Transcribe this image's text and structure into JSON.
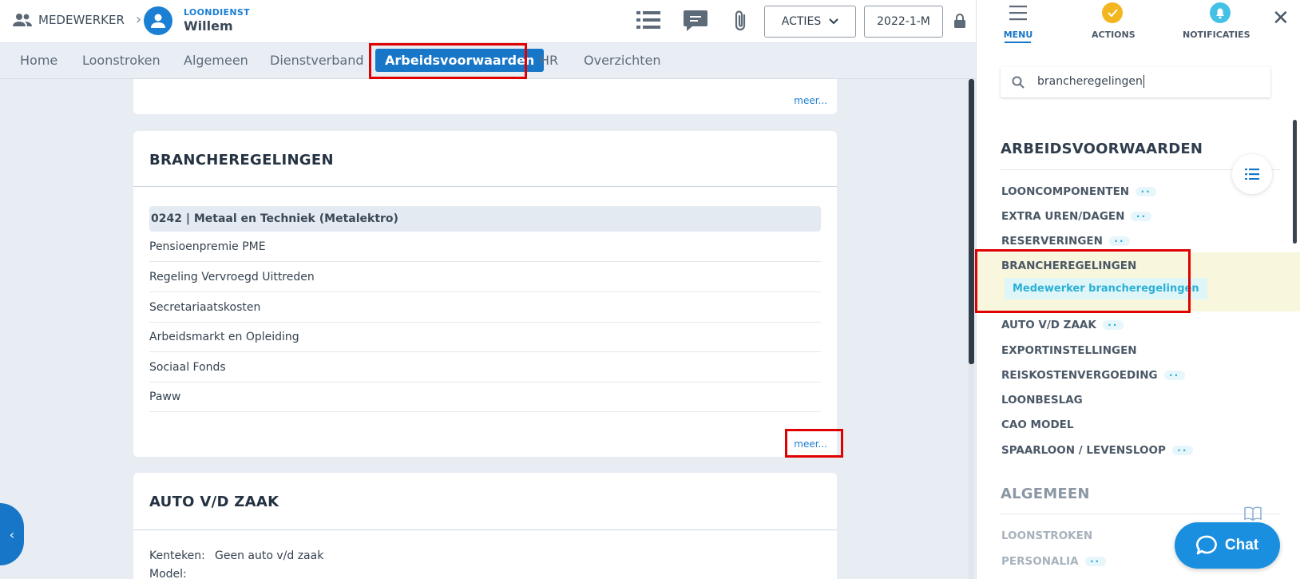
{
  "header": {
    "crumb_label": "MEDEWERKER",
    "emp_subtitle": "LOONDIENST",
    "emp_name": "Willem",
    "acties_label": "ACTIES",
    "period_label": "2022-1-M"
  },
  "tabs": [
    "Home",
    "Loonstroken",
    "Algemeen",
    "Dienstverband",
    "Arbeidsvoorwaarden",
    "HR",
    "Overzichten"
  ],
  "main": {
    "meer_label": "meer...",
    "branche_card": {
      "title": "BRANCHEREGELINGEN",
      "highlight_row": "0242 | Metaal en Techniek (Metalektro)",
      "rows": [
        "Pensioenpremie PME",
        "Regeling Vervroegd Uittreden",
        "Secretariaatskosten",
        "Arbeidsmarkt en Opleiding",
        "Sociaal Fonds",
        "Paww"
      ]
    },
    "auto_card": {
      "title": "AUTO V/D ZAAK",
      "kenteken_key": "Kenteken:",
      "kenteken_value": "Geen auto v/d zaak",
      "model_key": "Model:"
    }
  },
  "panel": {
    "tabs": [
      "MENU",
      "ACTIONS",
      "NOTIFICATIES"
    ],
    "search_value": "brancheregelingen",
    "section1_title": "ARBEIDSVOORWAARDEN",
    "items": [
      "LOONCOMPONENTEN",
      "EXTRA UREN/DAGEN",
      "RESERVERINGEN",
      "BRANCHEREGELINGEN",
      "AUTO V/D ZAAK",
      "EXPORTINSTELLINGEN",
      "REISKOSTENVERGOEDING",
      "LOONBESLAG",
      "CAO MODEL",
      "SPAARLOON / LEVENSLOOP"
    ],
    "sub_item": "Medewerker brancheregelingen",
    "section2_title": "ALGEMEEN",
    "items2": [
      "LOONSTROKEN",
      "PERSONALIA"
    ],
    "dots": ".."
  },
  "chat_label": "Chat",
  "colors": {
    "accent": "#1776c8",
    "highlight": "#e00000",
    "sub_item": "#2ab0d6"
  }
}
